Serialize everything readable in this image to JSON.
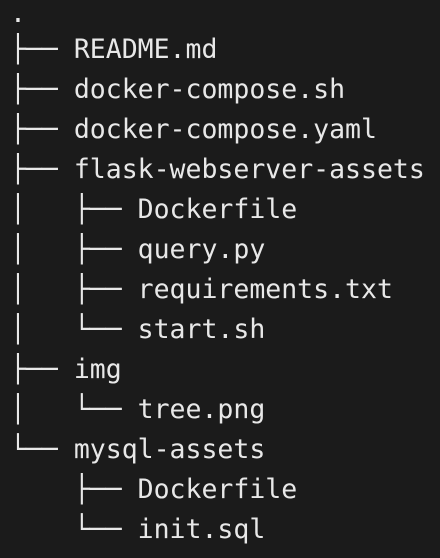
{
  "colors": {
    "background": "#1b1b1b",
    "text": "#e8e8e8"
  },
  "tree": {
    "lines": [
      {
        "prefix": ".",
        "name": ""
      },
      {
        "prefix": "├── ",
        "name": "README.md"
      },
      {
        "prefix": "├── ",
        "name": "docker-compose.sh"
      },
      {
        "prefix": "├── ",
        "name": "docker-compose.yaml"
      },
      {
        "prefix": "├── ",
        "name": "flask-webserver-assets"
      },
      {
        "prefix": "│   ├── ",
        "name": "Dockerfile"
      },
      {
        "prefix": "│   ├── ",
        "name": "query.py"
      },
      {
        "prefix": "│   ├── ",
        "name": "requirements.txt"
      },
      {
        "prefix": "│   └── ",
        "name": "start.sh"
      },
      {
        "prefix": "├── ",
        "name": "img"
      },
      {
        "prefix": "│   └── ",
        "name": "tree.png"
      },
      {
        "prefix": "└── ",
        "name": "mysql-assets"
      },
      {
        "prefix": "    ├── ",
        "name": "Dockerfile"
      },
      {
        "prefix": "    └── ",
        "name": "init.sql"
      }
    ]
  }
}
